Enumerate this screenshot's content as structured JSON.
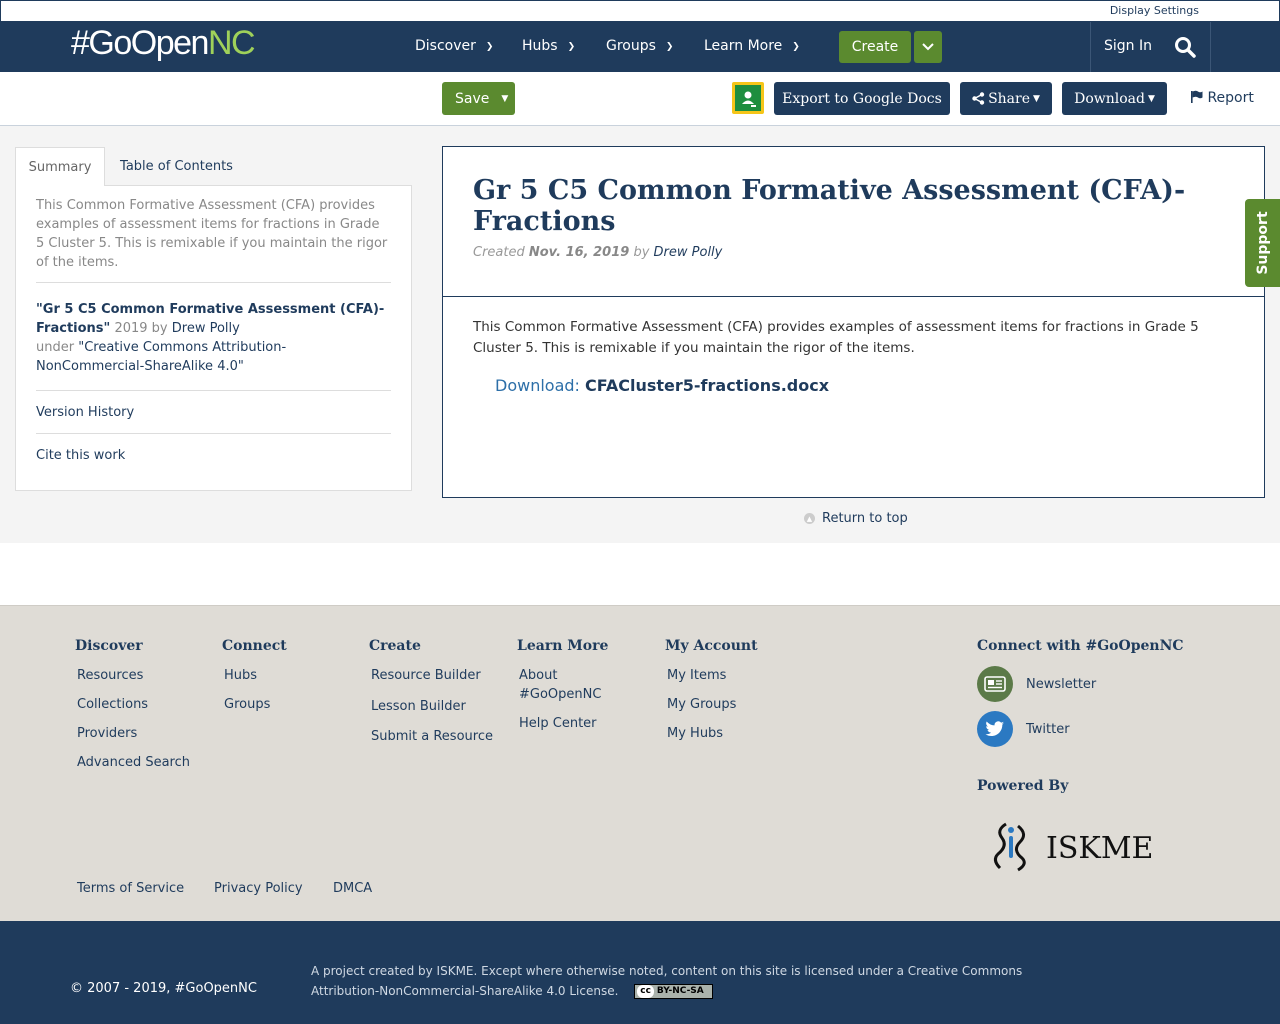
{
  "util": {
    "display_settings": "Display Settings"
  },
  "nav": {
    "logo_main": "#GoOpen",
    "logo_accent": "NC",
    "items": [
      {
        "label": "Discover"
      },
      {
        "label": "Hubs"
      },
      {
        "label": "Groups"
      },
      {
        "label": "Learn More"
      }
    ],
    "create_label": "Create",
    "signin_label": "Sign In"
  },
  "actions": {
    "save_label": "Save",
    "export_label": "Export to Google Docs",
    "share_label": "Share",
    "download_label": "Download",
    "report_label": "Report"
  },
  "left": {
    "tabs": [
      {
        "label": "Summary"
      },
      {
        "label": "Table of Contents"
      }
    ],
    "description": "This Common Formative Assessment (CFA) provides examples of assessment items for fractions in Grade 5 Cluster 5. This is remixable if you maintain the rigor of the items.",
    "attribution": {
      "title": "\"Gr 5 C5 Common Formative Assessment (CFA)-Fractions\"",
      "year_by": " 2019 by ",
      "author": "Drew Polly",
      "under": "under ",
      "license": "\"Creative Commons Attribution-NonCommercial-ShareAlike 4.0\""
    },
    "version_history": "Version History",
    "cite": "Cite this work"
  },
  "card": {
    "title": "Gr 5 C5 Common Formative Assessment (CFA)-Fractions",
    "created_prefix": "Created ",
    "created_date": "Nov. 16, 2019",
    "by": " by ",
    "author": "Drew Polly",
    "description": "This Common Formative Assessment (CFA) provides examples of assessment items for fractions in Grade 5 Cluster 5. This is remixable if you maintain the rigor of the items.",
    "download_label": "Download: ",
    "download_file": "CFACluster5-fractions.docx"
  },
  "return_top": "Return to top",
  "support": "Support",
  "footer": {
    "columns": [
      {
        "heading": "Discover",
        "links": [
          "Resources",
          "Collections",
          "Providers",
          "Advanced Search"
        ]
      },
      {
        "heading": "Connect",
        "links": [
          "Hubs",
          "Groups"
        ]
      },
      {
        "heading": "Create",
        "links": [
          "Resource Builder",
          "Lesson Builder",
          "Submit a Resource"
        ]
      },
      {
        "heading": "Learn More",
        "links": [
          "About #GoOpenNC",
          "Help Center"
        ]
      },
      {
        "heading": "My Account",
        "links": [
          "My Items",
          "My Groups",
          "My Hubs"
        ]
      }
    ],
    "social_heading": "Connect with #GoOpenNC",
    "newsletter": "Newsletter",
    "twitter": "Twitter",
    "powered_by": "Powered By",
    "iskme_text": "ISKME",
    "legal": [
      "Terms of Service",
      "Privacy Policy",
      "DMCA"
    ]
  },
  "bottom": {
    "copyright": "© 2007 - 2019, #GoOpenNC",
    "note": "A project created by ISKME. Except where otherwise noted, content on this site is licensed under a Creative Commons Attribution-NonCommercial-ShareAlike 4.0 License.",
    "badge_cc": "cc",
    "badge_text": "BY-NC-SA"
  },
  "colors": {
    "brand_navy": "#1f3b5c",
    "brand_green": "#5b8a2f",
    "logo_accent": "#9fd15a"
  }
}
